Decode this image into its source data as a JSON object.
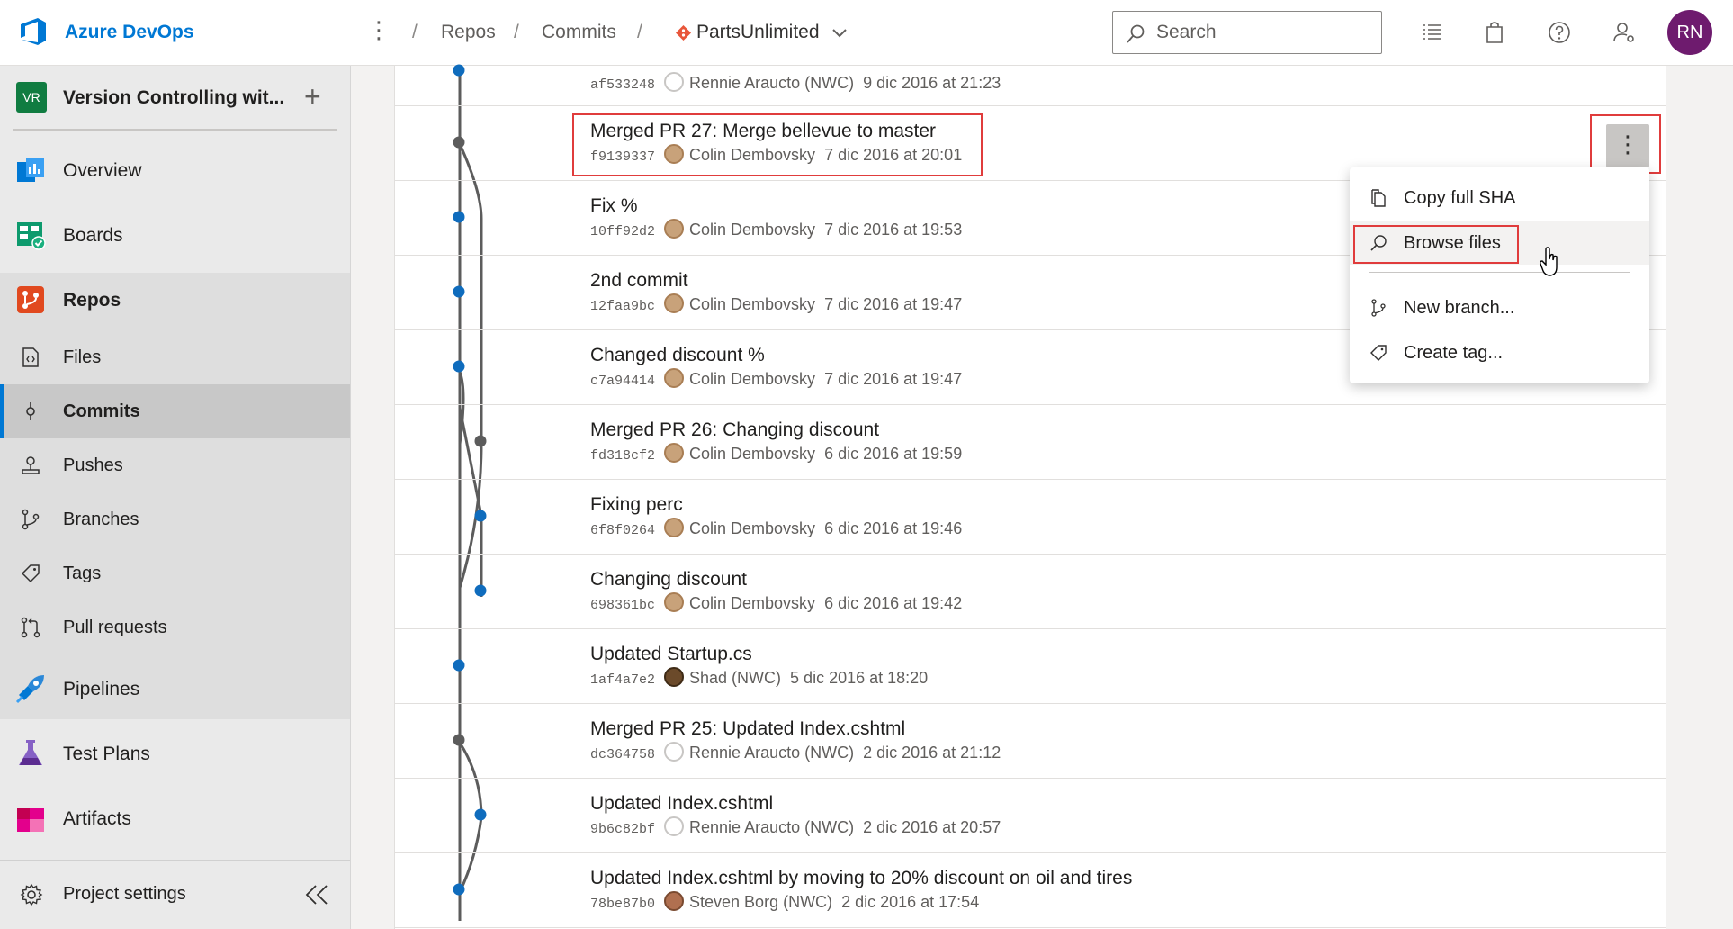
{
  "topbar": {
    "brand": "Azure DevOps",
    "more_label": "⋮",
    "breadcrumb": [
      "Repos",
      "Commits"
    ],
    "separator": "/",
    "repo": "PartsUnlimited",
    "search_placeholder": "Search",
    "avatar_initials": "RN"
  },
  "sidebar": {
    "project_badge": "VR",
    "project_name": "Version Controlling wit...",
    "add_label": "+",
    "items": [
      {
        "label": "Overview",
        "icon": "overview-icon"
      },
      {
        "label": "Boards",
        "icon": "boards-icon"
      },
      {
        "label": "Repos",
        "icon": "repos-icon"
      },
      {
        "label": "Pipelines",
        "icon": "pipelines-icon"
      },
      {
        "label": "Test Plans",
        "icon": "test-plans-icon"
      },
      {
        "label": "Artifacts",
        "icon": "artifacts-icon"
      }
    ],
    "repo_items": [
      {
        "label": "Files",
        "icon": "files-icon"
      },
      {
        "label": "Commits",
        "icon": "commit-icon"
      },
      {
        "label": "Pushes",
        "icon": "pushes-icon"
      },
      {
        "label": "Branches",
        "icon": "branch-icon"
      },
      {
        "label": "Tags",
        "icon": "tag-icon"
      },
      {
        "label": "Pull requests",
        "icon": "pull-request-icon"
      }
    ],
    "settings_label": "Project settings",
    "collapse_icon": "collapse-icon"
  },
  "commits": [
    {
      "message": "",
      "sha": "af533248",
      "author": "Rennie Araucto (NWC)",
      "date": "9 dic 2016 at 21:23",
      "avatar": "none"
    },
    {
      "message": "Merged PR 27: Merge bellevue to master",
      "sha": "f9139337",
      "author": "Colin Dembovsky",
      "date": "7 dic 2016 at 20:01",
      "avatar": "colin"
    },
    {
      "message": "Fix %",
      "sha": "10ff92d2",
      "author": "Colin Dembovsky",
      "date": "7 dic 2016 at 19:53",
      "avatar": "colin"
    },
    {
      "message": "2nd commit",
      "sha": "12faa9bc",
      "author": "Colin Dembovsky",
      "date": "7 dic 2016 at 19:47",
      "avatar": "colin"
    },
    {
      "message": "Changed discount %",
      "sha": "c7a94414",
      "author": "Colin Dembovsky",
      "date": "7 dic 2016 at 19:47",
      "avatar": "colin"
    },
    {
      "message": "Merged PR 26: Changing discount",
      "sha": "fd318cf2",
      "author": "Colin Dembovsky",
      "date": "6 dic 2016 at 19:59",
      "avatar": "colin"
    },
    {
      "message": "Fixing perc",
      "sha": "6f8f0264",
      "author": "Colin Dembovsky",
      "date": "6 dic 2016 at 19:46",
      "avatar": "colin"
    },
    {
      "message": "Changing discount",
      "sha": "698361bc",
      "author": "Colin Dembovsky",
      "date": "6 dic 2016 at 19:42",
      "avatar": "colin"
    },
    {
      "message": "Updated Startup.cs",
      "sha": "1af4a7e2",
      "author": "Shad (NWC)",
      "date": "5 dic 2016 at 18:20",
      "avatar": "shad"
    },
    {
      "message": "Merged PR 25: Updated Index.cshtml",
      "sha": "dc364758",
      "author": "Rennie Araucto (NWC)",
      "date": "2 dic 2016 at 21:12",
      "avatar": "none"
    },
    {
      "message": "Updated Index.cshtml",
      "sha": "9b6c82bf",
      "author": "Rennie Araucto (NWC)",
      "date": "2 dic 2016 at 20:57",
      "avatar": "none"
    },
    {
      "message": "Updated Index.cshtml by moving to 20% discount on oil and tires",
      "sha": "78be87b0",
      "author": "Steven Borg (NWC)",
      "date": "2 dic 2016 at 17:54",
      "avatar": "steven"
    }
  ],
  "row_more_label": "⋮",
  "context_menu": {
    "items": [
      {
        "label": "Copy full SHA",
        "icon": "copy-icon"
      },
      {
        "label": "Browse files",
        "icon": "search-icon"
      },
      {
        "label": "New branch...",
        "icon": "branch-icon"
      },
      {
        "label": "Create tag...",
        "icon": "tag-icon"
      }
    ]
  },
  "colors": {
    "accent": "#0078d4",
    "highlight": "#e03c3c",
    "merge_node": "#5c5c5c",
    "commit_node": "#0f6cbd"
  }
}
